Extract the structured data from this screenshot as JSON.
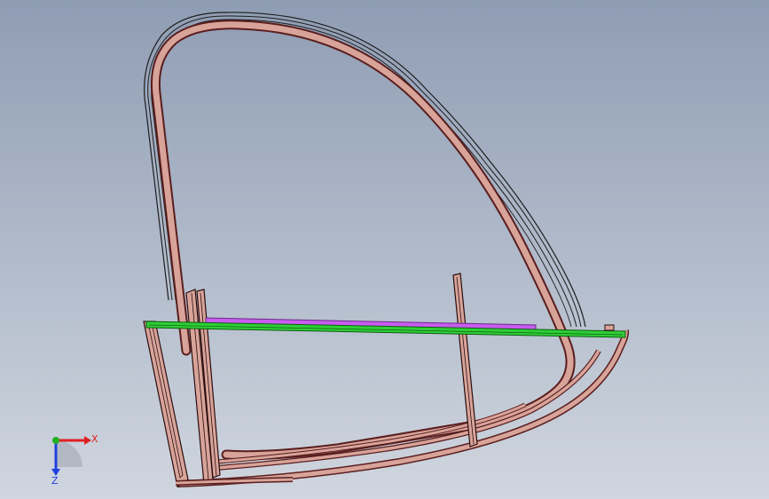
{
  "viewport": {
    "background_top": "#8f9db4",
    "background_bottom": "#d0d6df"
  },
  "colors": {
    "frame_fill": "#d8a49a",
    "frame_edge": "#5a1e1e",
    "frame_dark": "#2a0d0d",
    "wire_edge": "#1e1e1e",
    "green_bar": "#2fcf37",
    "green_edge": "#0d5e11",
    "magenta_bar": "#c95cf0",
    "magenta_edge": "#6b2a8a",
    "axis_x": "#e02020",
    "axis_y": "#20b020",
    "axis_z": "#2040e0"
  },
  "triad": {
    "x_label": "X",
    "z_label": "Z",
    "icon": "coordinate-triad-icon"
  }
}
